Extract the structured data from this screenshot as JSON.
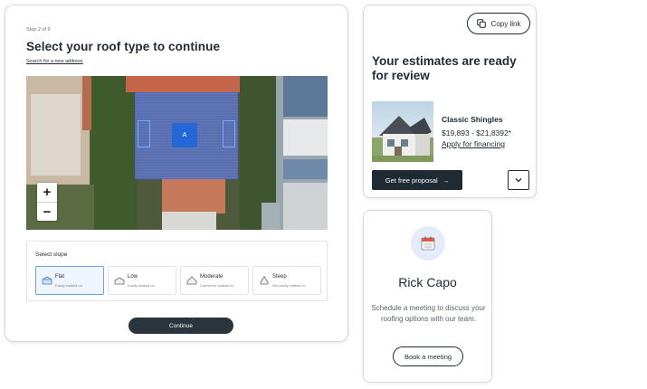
{
  "wizard": {
    "step": "Step 2 of 9",
    "title": "Select your roof type to continue",
    "search_link": "Search for a new address",
    "map": {
      "marker_label": "A",
      "zoom_in": "+",
      "zoom_out": "−"
    },
    "slope": {
      "label": "Select slope",
      "options": [
        {
          "name": "Flat",
          "desc": "Easily walked on",
          "selected": true
        },
        {
          "name": "Low",
          "desc": "Easily walked on",
          "selected": false
        },
        {
          "name": "Moderate",
          "desc": "Cannot be walked on",
          "selected": false
        },
        {
          "name": "Steep",
          "desc": "Not easily walked on",
          "selected": false
        }
      ]
    },
    "continue_label": "Continue"
  },
  "estimate": {
    "copy_link": "Copy link",
    "title": "Your estimates are ready for review",
    "product": {
      "name": "Classic Shingles",
      "price": "$19,893 - $21,8392*",
      "financing": "Apply for financing"
    },
    "proposal_button": "Get free proposal",
    "proposal_arrow": "→"
  },
  "contact": {
    "name": "Rick Capo",
    "message": "Schedule a meeting to discuss your roofing options with our team.",
    "button": "Book a meeting"
  },
  "colors": {
    "primary_dark": "#1f2a33",
    "roof_highlight": "#5c74d2",
    "marker_blue": "#2468d8",
    "selected_border": "#6aa3df"
  },
  "icons": [
    "house-roof-icon",
    "copy-icon",
    "chevron-down-icon",
    "calendar-icon",
    "arrow-right-icon"
  ]
}
